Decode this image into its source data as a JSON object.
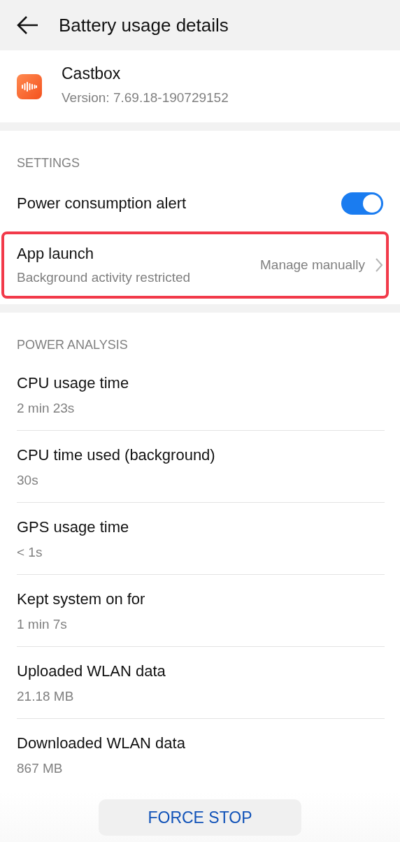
{
  "header": {
    "title": "Battery usage details"
  },
  "app": {
    "name": "Castbox",
    "version": "Version: 7.69.18-190729152"
  },
  "settings": {
    "heading": "SETTINGS",
    "items": [
      {
        "kind": "toggle",
        "label": "Power consumption alert",
        "on": true,
        "highlighted": false
      },
      {
        "kind": "link",
        "label": "App launch",
        "subtitle": "Background activity restricted",
        "value": "Manage manually",
        "highlighted": true
      }
    ]
  },
  "power_analysis": {
    "heading": "POWER ANALYSIS",
    "rows": [
      {
        "label": "CPU usage time",
        "value": "2 min 23s"
      },
      {
        "label": "CPU time used (background)",
        "value": "30s"
      },
      {
        "label": "GPS usage time",
        "value": "< 1s"
      },
      {
        "label": "Kept system on for",
        "value": "1 min 7s"
      },
      {
        "label": "Uploaded WLAN data",
        "value": "21.18 MB"
      },
      {
        "label": "Downloaded WLAN data",
        "value": "867 MB"
      }
    ]
  },
  "force_stop": {
    "label": "FORCE STOP"
  }
}
